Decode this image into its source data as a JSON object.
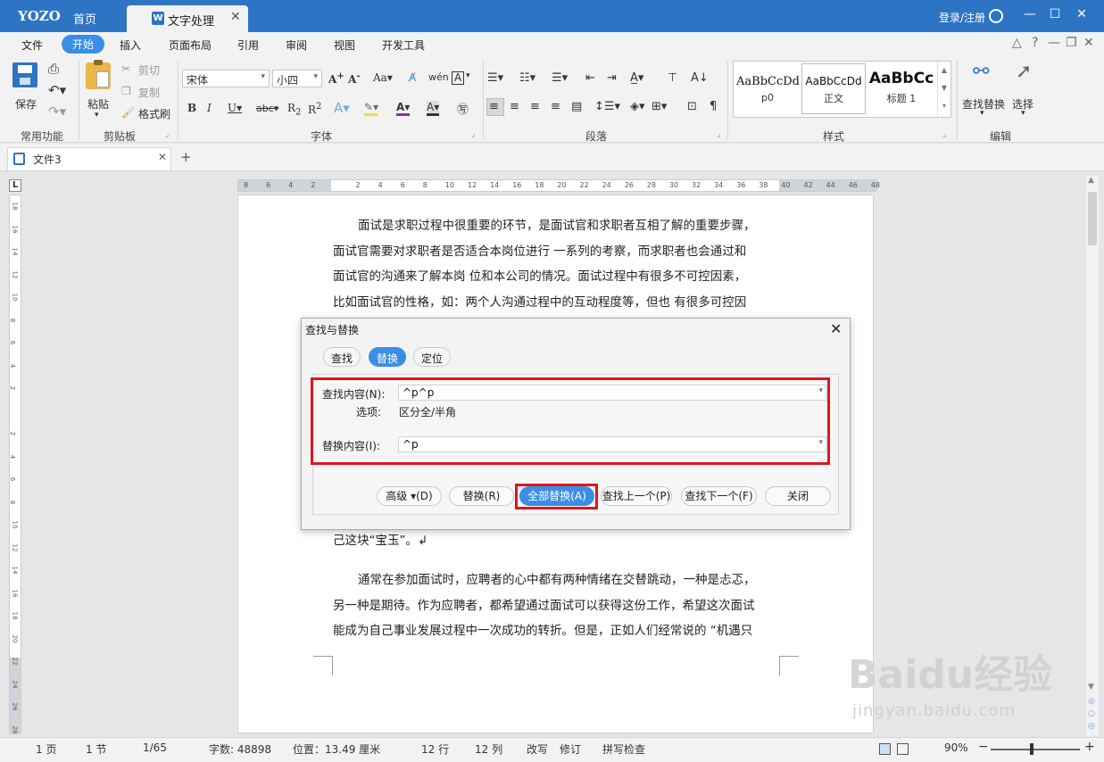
{
  "titlebar": {
    "logo": "YOZO",
    "home": "首页",
    "doc_tab": "文字处理",
    "doc_tab_icon": "W",
    "login": "登录/注册"
  },
  "menu": {
    "items": [
      "文件",
      "开始",
      "插入",
      "页面布局",
      "引用",
      "审阅",
      "视图",
      "开发工具"
    ],
    "active": "开始"
  },
  "ribbon": {
    "common": {
      "save": "保存",
      "group": "常用功能"
    },
    "clipboard": {
      "paste": "粘贴",
      "cut": "剪切",
      "copy": "复制",
      "format_painter": "格式刷",
      "group": "剪贴板"
    },
    "font": {
      "name": "宋体",
      "size": "小四",
      "group": "字体"
    },
    "paragraph": {
      "group": "段落"
    },
    "styles": {
      "items": [
        {
          "sample": "AaBbCcDd",
          "label": "p0"
        },
        {
          "sample": "AaBbCcDd",
          "label": "正文"
        },
        {
          "sample": "AaBbCc",
          "label": "标题 1"
        }
      ],
      "group": "样式"
    },
    "edit": {
      "find_replace": "查找替换",
      "select": "选择",
      "group": "编辑"
    }
  },
  "file_tab": {
    "name": "文件3",
    "add": "+"
  },
  "ruler": {
    "top": [
      "8",
      "6",
      "4",
      "2",
      "",
      "2",
      "4",
      "6",
      "8",
      "10",
      "12",
      "14",
      "16",
      "18",
      "20",
      "22",
      "24",
      "26",
      "28",
      "30",
      "32",
      "34",
      "36",
      "38",
      "40",
      "42",
      "44",
      "46",
      "48"
    ],
    "left": [
      "18",
      "16",
      "14",
      "12",
      "10",
      "8",
      "6",
      "4",
      "2",
      "",
      "2",
      "4",
      "6",
      "8",
      "10",
      "12",
      "14",
      "16",
      "18",
      "20",
      "22",
      "24",
      "26",
      "28"
    ]
  },
  "document": {
    "para1": [
      "面试是求职过程中很重要的环节，是面试官和求职者互相了解的重要步骤，",
      "面试官需要对求职者是否适合本岗位进行   一系列的考察，而求职者也会通过和",
      "面试官的沟通来了解本岗   位和本公司的情况。面试过程中有很多不可控因素，",
      "比如面试官的性格，如：两个人沟通过程中的互动程度等，但也   有很多可控因"
    ],
    "para_end": "己这块“宝玉”。↲",
    "para2": [
      "通常在参加面试时，应聘者的心中都有两种情绪在交替跳动，一种是忐忑，",
      "另一种是期待。作为应聘者，都希望通过面试可以获得这份工作，希望这次面试",
      "能成为自己事业发展过程中一次成功的转折。但是，正如人们经常说的 “机遇只"
    ]
  },
  "dialog": {
    "title": "查找与替换",
    "tabs": [
      "查找",
      "替换",
      "定位"
    ],
    "active_tab": "替换",
    "find_label": "查找内容(N):",
    "find_value": "^p^p",
    "options_label": "选项:",
    "options_value": "区分全/半角",
    "replace_label": "替换内容(I):",
    "replace_value": "^p",
    "buttons": {
      "advanced": "高级 ▾(D)",
      "replace": "替换(R)",
      "replace_all": "全部替换(A)",
      "find_prev": "查找上一个(P)",
      "find_next": "查找下一个(F)",
      "close": "关闭"
    },
    "highlight_color": "#e2141d"
  },
  "status": {
    "page": "1 页",
    "section": "1 节",
    "page_of": "1/65",
    "word_count": "字数: 48898",
    "position": "位置：13.49 厘米",
    "line": "12 行",
    "column": "12 列",
    "overwrite": "改写",
    "revise": "修订",
    "spellcheck": "拼写检查",
    "zoom": "90%"
  },
  "watermark": {
    "brand": "Baidu经验",
    "url": "jingyan.baidu.com"
  },
  "colors": {
    "titlebar": "#2e74c5",
    "accent": "#3a8ee6",
    "highlight": "#e2141d"
  }
}
